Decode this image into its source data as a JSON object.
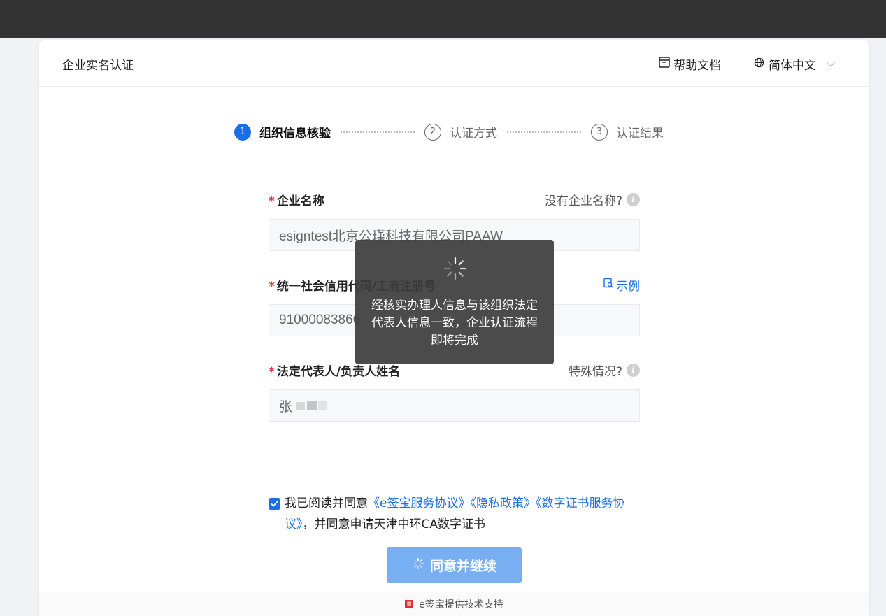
{
  "header": {
    "title": "企业实名认证",
    "help_label": "帮助文档",
    "language": "简体中文"
  },
  "steps": [
    {
      "number": "1",
      "label": "组织信息核验",
      "active": true
    },
    {
      "number": "2",
      "label": "认证方式",
      "active": false
    },
    {
      "number": "3",
      "label": "认证结果",
      "active": false
    }
  ],
  "form": {
    "company_name": {
      "required_mark": "*",
      "label": "企业名称",
      "hint": "没有企业名称?",
      "value": "esigntest北京公瑾科技有限公司PAAW"
    },
    "credit_code": {
      "required_mark": "*",
      "label": "统一社会信用代码/工商注册号",
      "example": "示例",
      "value": "91000083866"
    },
    "legal_rep": {
      "required_mark": "*",
      "label": "法定代表人/负责人姓名",
      "hint": "特殊情况?",
      "value": "张"
    }
  },
  "agreement": {
    "prefix": "我已阅读并同意",
    "links": [
      "《e签宝服务协议》",
      "《隐私政策》",
      "《数字证书服务协议》"
    ],
    "suffix": "，并同意申请天津中环CA数字证书"
  },
  "submit_label": "同意并继续",
  "footer_text": "e签宝提供技术支持",
  "toast": {
    "message": "经核实办理人信息与该组织法定代表人信息一致，企业认证流程即将完成"
  },
  "colors": {
    "accent": "#1a6fe8",
    "topbar": "#333333",
    "button_disabled": "#78aef2",
    "required": "#e4393c"
  },
  "icons": {
    "help": "book-icon",
    "language": "globe-icon",
    "spinner": "loading-spinner-icon",
    "example": "document-search-icon",
    "info": "info-icon"
  }
}
